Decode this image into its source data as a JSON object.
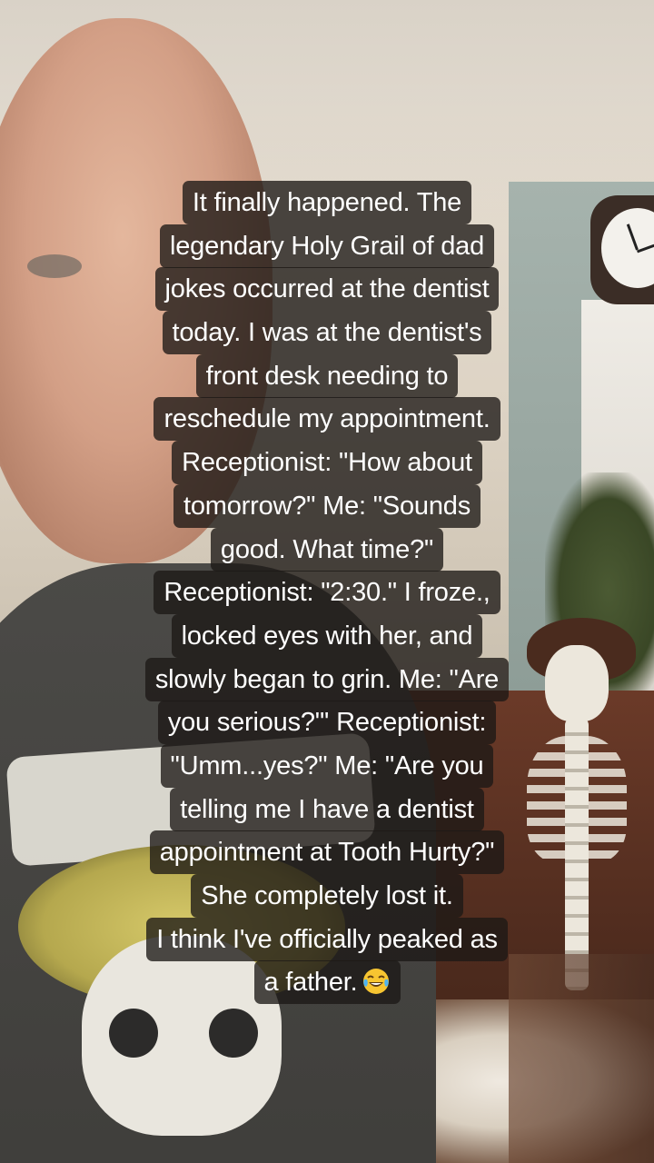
{
  "scene": {
    "description_tags": [
      "selfie-man",
      "wall-clock",
      "skeleton-decoration",
      "house-plant",
      "graphic-tee"
    ]
  },
  "caption": {
    "lines": [
      "It finally happened. The",
      "legendary Holy Grail of dad",
      "jokes occurred at the dentist",
      "today. I was at the dentist's",
      "front desk needing to",
      "reschedule my appointment.",
      "Receptionist: \"How about",
      "tomorrow?\" Me: \"Sounds",
      "good. What time?\"",
      "Receptionist: \"2:30.\" I froze.,",
      "locked eyes with her, and",
      "slowly began to grin. Me: \"Are",
      "you serious?\"' Receptionist:",
      "\"Umm...yes?\" Me: \"Are you",
      "telling me I have a dentist",
      "appointment at Tooth Hurty?\"",
      "She completely lost it.",
      "I think I've officially peaked as",
      "a father."
    ],
    "emoji": "face-with-tears-of-joy-icon",
    "text_color": "#ffffff",
    "box_color": "#1c1816"
  }
}
